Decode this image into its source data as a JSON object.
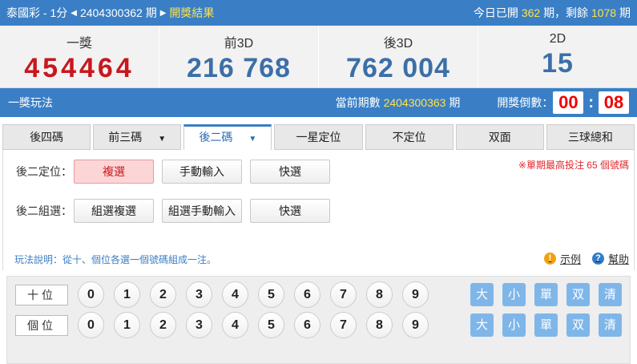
{
  "header": {
    "game": "泰國彩 - 1分",
    "period": "2404300362",
    "period_suffix": "期",
    "results_link": "開獎結果",
    "today_prefix": "今日已開",
    "today_count": "362",
    "today_mid": "期，剩餘",
    "remaining": "1078",
    "remaining_suffix": "期"
  },
  "results": [
    {
      "label": "一獎",
      "value": "454464"
    },
    {
      "label": "前3D",
      "value": "216 768"
    },
    {
      "label": "後3D",
      "value": "762 004"
    },
    {
      "label": "2D",
      "value": "15"
    }
  ],
  "playbar": {
    "title": "一獎玩法",
    "current_label": "當前期數",
    "current_period": "2404300363",
    "current_suffix": "期",
    "countdown_label": "開獎倒數：",
    "minutes": "00",
    "seconds": "08"
  },
  "tabs": [
    {
      "label": "後四碼",
      "caret": ""
    },
    {
      "label": "前三碼",
      "caret": "▼"
    },
    {
      "label": "後二碼",
      "caret": "▼"
    },
    {
      "label": "一星定位",
      "caret": ""
    },
    {
      "label": "不定位",
      "caret": ""
    },
    {
      "label": "双面",
      "caret": ""
    },
    {
      "label": "三球總和",
      "caret": ""
    }
  ],
  "rows": [
    {
      "label": "後二定位：",
      "buttons": [
        "複選",
        "手動輸入",
        "快選"
      ]
    },
    {
      "label": "後二組選：",
      "buttons": [
        "組選複選",
        "組選手動輸入",
        "快選"
      ]
    }
  ],
  "limit_note": "※單期最高投注 65 個號碼",
  "description": "玩法說明：從十、個位各選一個號碼組成一注。",
  "links": {
    "example": "示例",
    "help": "幫助"
  },
  "board": {
    "positions": [
      "十位",
      "個位"
    ],
    "numbers": [
      "0",
      "1",
      "2",
      "3",
      "4",
      "5",
      "6",
      "7",
      "8",
      "9"
    ],
    "filters": [
      "大",
      "小",
      "單",
      "双",
      "清"
    ]
  }
}
